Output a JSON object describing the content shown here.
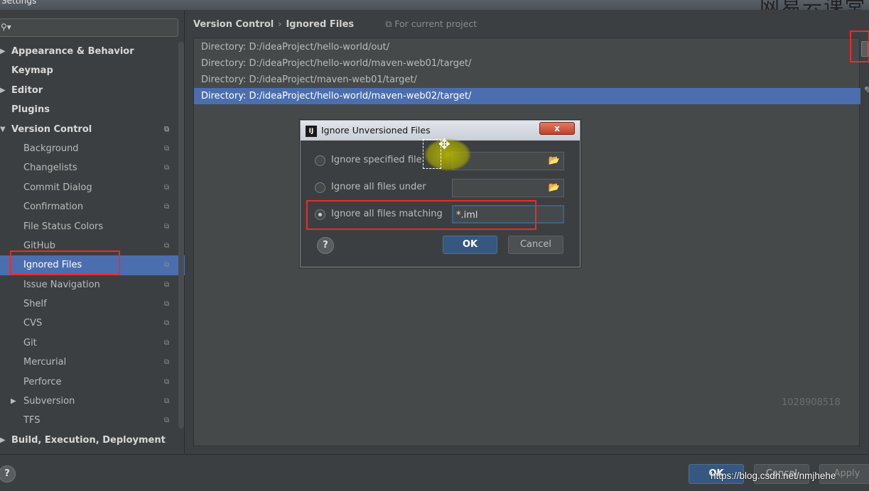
{
  "window": {
    "title": "Settings",
    "watermark": "网易云课堂"
  },
  "search": {
    "icon": "search-icon"
  },
  "tree": [
    {
      "label": "Appearance & Behavior",
      "level": 0,
      "arrow": "▶"
    },
    {
      "label": "Keymap",
      "level": 0
    },
    {
      "label": "Editor",
      "level": 0,
      "arrow": "▶"
    },
    {
      "label": "Plugins",
      "level": 0
    },
    {
      "label": "Version Control",
      "level": 0,
      "arrow": "▼",
      "proj": true
    },
    {
      "label": "Background",
      "level": 1,
      "proj": true
    },
    {
      "label": "Changelists",
      "level": 1,
      "proj": true
    },
    {
      "label": "Commit Dialog",
      "level": 1,
      "proj": true
    },
    {
      "label": "Confirmation",
      "level": 1,
      "proj": true
    },
    {
      "label": "File Status Colors",
      "level": 1,
      "proj": true
    },
    {
      "label": "GitHub",
      "level": 1,
      "proj": true
    },
    {
      "label": "Ignored Files",
      "level": 1,
      "proj": true,
      "selected": true
    },
    {
      "label": "Issue Navigation",
      "level": 1,
      "proj": true
    },
    {
      "label": "Shelf",
      "level": 1,
      "proj": true
    },
    {
      "label": "CVS",
      "level": 1,
      "proj": true
    },
    {
      "label": "Git",
      "level": 1,
      "proj": true
    },
    {
      "label": "Mercurial",
      "level": 1,
      "proj": true
    },
    {
      "label": "Perforce",
      "level": 1,
      "proj": true
    },
    {
      "label": "Subversion",
      "level": 1,
      "proj": true,
      "arrow": "▶"
    },
    {
      "label": "TFS",
      "level": 1,
      "proj": true
    },
    {
      "label": "Build, Execution, Deployment",
      "level": 0,
      "arrow": "▶"
    }
  ],
  "breadcrumb": {
    "parent": "Version Control",
    "separator": "›",
    "current": "Ignored Files",
    "scope": "For current project"
  },
  "ignored_list": [
    "Directory: D:/ideaProject/hello-world/out/",
    "Directory: D:/ideaProject/hello-world/maven-web01/target/",
    "Directory: D:/ideaProject/maven-web01/target/",
    "Directory: D:/ideaProject/hello-world/maven-web02/target/"
  ],
  "selected_index": 3,
  "id_watermark": "1028908518",
  "dialog": {
    "title": "Ignore Unversioned Files",
    "close_label": "x",
    "options": [
      {
        "label": "Ignore specified file",
        "checked": false,
        "value": ""
      },
      {
        "label": "Ignore all files under",
        "checked": false,
        "value": ""
      },
      {
        "label": "Ignore all files matching",
        "checked": true,
        "value": "*.iml"
      }
    ],
    "help_label": "?",
    "ok_label": "OK",
    "cancel_label": "Cancel"
  },
  "footer": {
    "help_label": "?",
    "ok_label": "OK",
    "cancel_label": "Cancel",
    "apply_label": "Apply",
    "url": "https://blog.csdn.net/nmjhehe"
  },
  "colors": {
    "selection": "#4b6eaf",
    "highlight": "#ee2a2a",
    "ok_button": "#365880"
  }
}
